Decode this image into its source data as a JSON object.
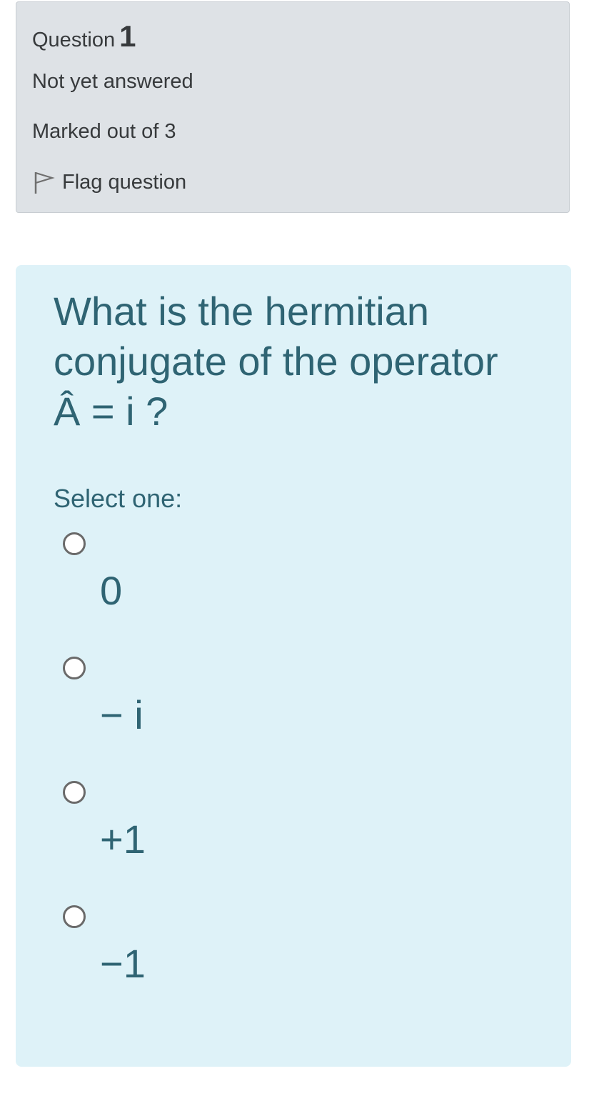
{
  "info": {
    "question_word": "Question",
    "question_number": "1",
    "state": "Not yet answered",
    "grade": "Marked out of 3",
    "flag_label": "Flag question",
    "flag_icon": "flag-outline-icon"
  },
  "question": {
    "text": "What is the hermitian conjugate of the operator Â = i ?",
    "prompt": "Select one:",
    "options": [
      {
        "label": "0",
        "selected": false
      },
      {
        "label": "− i",
        "selected": false
      },
      {
        "label": "+1",
        "selected": false
      },
      {
        "label": "−1",
        "selected": false
      }
    ]
  },
  "colors": {
    "info_background": "#dee2e6",
    "content_background": "#def2f8",
    "content_text": "#2f6473",
    "info_text": "#373a3c"
  }
}
